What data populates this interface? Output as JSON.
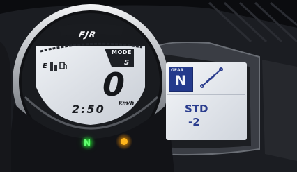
{
  "cluster": {
    "brand": "FJR",
    "mode_label": "MODE",
    "mode_value": "S",
    "fuel_empty_label": "E",
    "speed": "0",
    "speed_unit": "km/h",
    "clock": "2:50",
    "neutral_indicator": "N",
    "display": {
      "gear_label": "GEAR",
      "gear_value": "N",
      "suspension_icon": "shock-absorber-icon",
      "suspension_line1": "STD",
      "suspension_line2": "-2"
    },
    "colors": {
      "lcd_background": "#dfe3ea",
      "gear_badge": "#243a8c",
      "display_text": "#2b3d8e",
      "neutral_light": "#3dff4e",
      "warning_light": "#ff9a00"
    }
  }
}
